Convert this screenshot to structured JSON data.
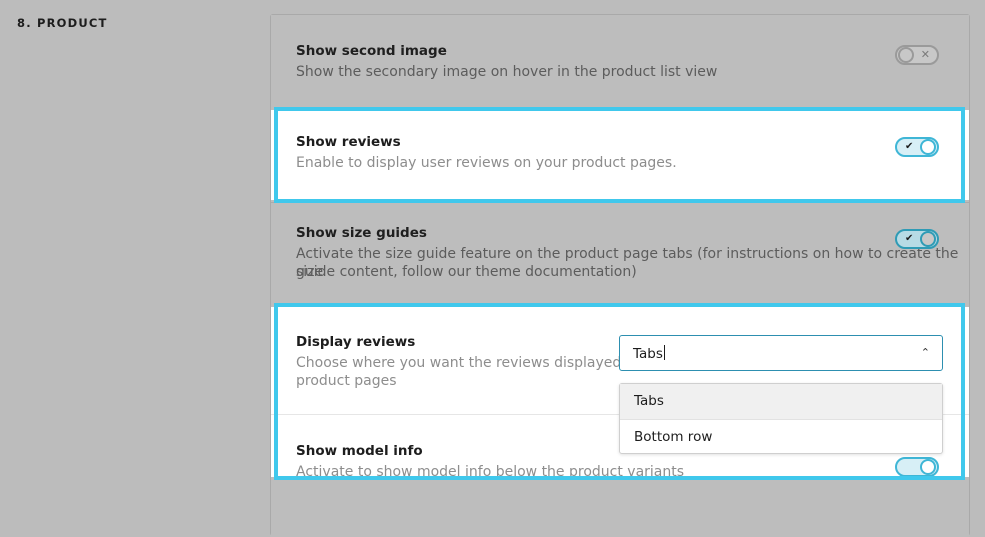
{
  "section_label": "8. PRODUCT",
  "settings": {
    "second_image": {
      "title": "Show second image",
      "desc": "Show the secondary image on hover in the product list view",
      "toggle_state": "off",
      "toggle_icon": "close-icon"
    },
    "reviews": {
      "title": "Show reviews",
      "desc": "Enable to display user reviews on your product pages.",
      "toggle_state": "on",
      "toggle_icon": "check-icon"
    },
    "size_guides": {
      "title": "Show size guides",
      "desc_line1": "Activate the size guide feature on the product page tabs (for instructions on how to create the size",
      "desc_line2": "guide content, follow our theme documentation)",
      "toggle_state": "on",
      "toggle_icon": "check-icon"
    },
    "display_reviews": {
      "title": "Display reviews",
      "desc_line1": "Choose where you want the reviews displayed on",
      "desc_line2": "product pages",
      "select_value": "Tabs",
      "options": [
        "Tabs",
        "Bottom row"
      ],
      "chevron_icon": "chevron-up-icon"
    },
    "model_info": {
      "title": "Show model info",
      "desc": "Activate to show model info below the product variants",
      "toggle_state": "on"
    }
  },
  "colors": {
    "highlight": "#40c8ec",
    "toggle_on": "#3fb6d6",
    "overlay_bg": "#bcbcbc"
  }
}
